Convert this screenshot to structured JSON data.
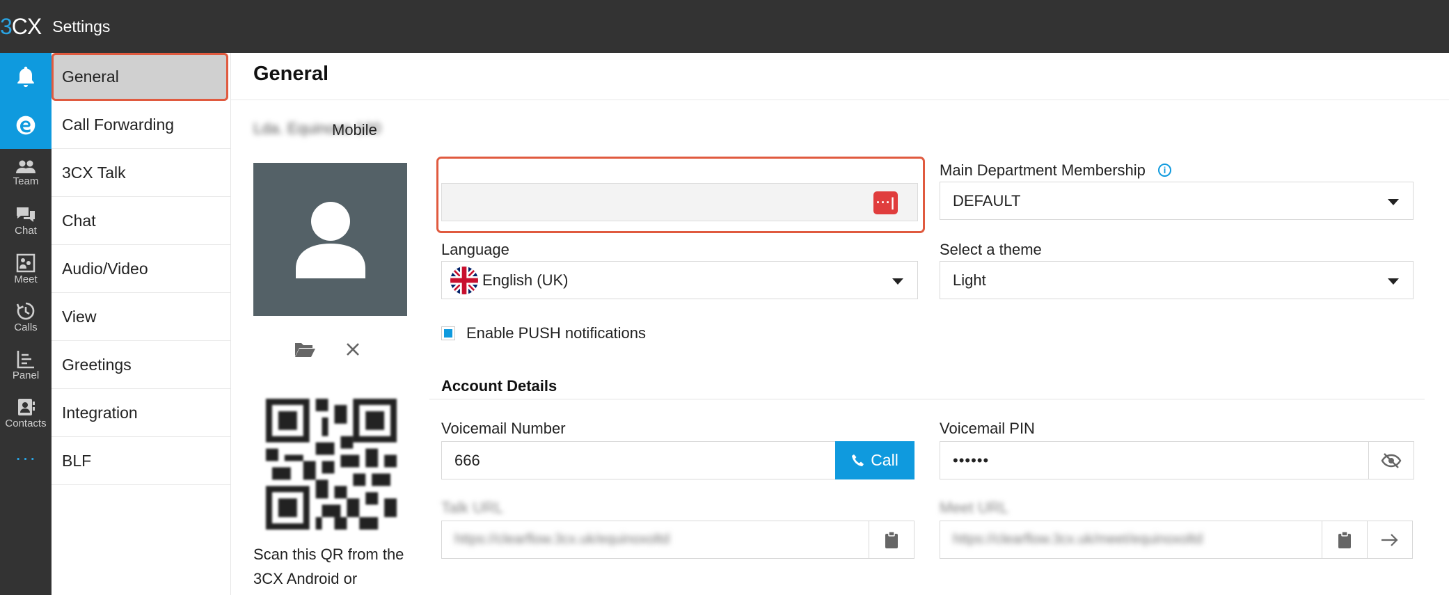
{
  "app": {
    "logo": "3CX",
    "title": "Settings"
  },
  "rail": [
    {
      "name": "notifications",
      "label": ""
    },
    {
      "name": "edge",
      "label": ""
    },
    {
      "name": "team",
      "label": "Team"
    },
    {
      "name": "chat",
      "label": "Chat"
    },
    {
      "name": "meet",
      "label": "Meet"
    },
    {
      "name": "calls",
      "label": "Calls"
    },
    {
      "name": "panel",
      "label": "Panel"
    },
    {
      "name": "contacts",
      "label": "Contacts"
    },
    {
      "name": "more",
      "label": "···"
    }
  ],
  "nav": {
    "items": [
      {
        "label": "General",
        "active": true
      },
      {
        "label": "Call Forwarding"
      },
      {
        "label": "3CX Talk"
      },
      {
        "label": "Chat"
      },
      {
        "label": "Audio/Video"
      },
      {
        "label": "View"
      },
      {
        "label": "Greetings"
      },
      {
        "label": "Integration"
      },
      {
        "label": "BLF"
      }
    ]
  },
  "main": {
    "title": "General",
    "extension_name": "Lda. Equinoxo 100",
    "qr_caption": "Scan this QR from the 3CX Android or",
    "mobile": {
      "label": "Mobile",
      "value": "",
      "badge": "···|"
    },
    "department": {
      "label": "Main Department Membership",
      "value": "DEFAULT"
    },
    "language": {
      "label": "Language",
      "value": "English (UK)"
    },
    "theme": {
      "label": "Select a theme",
      "value": "Light"
    },
    "push": {
      "label": "Enable PUSH notifications",
      "checked": true
    },
    "account_details": {
      "title": "Account Details",
      "voicemail_number": {
        "label": "Voicemail Number",
        "value": "666",
        "button": "Call"
      },
      "voicemail_pin": {
        "label": "Voicemail PIN",
        "value": "••••••"
      },
      "talk_url": {
        "label": "Talk URL",
        "value": "https://clearflow.3cx.uk/equinoxoltd"
      },
      "meet_url": {
        "label": "Meet URL",
        "value": "https://clearflow.3cx.uk/meet/equinoxoltd"
      }
    }
  },
  "colors": {
    "accent": "#0f9ade",
    "highlight": "#e05a3f",
    "topbar": "#333333",
    "badge": "#e03d3d"
  }
}
